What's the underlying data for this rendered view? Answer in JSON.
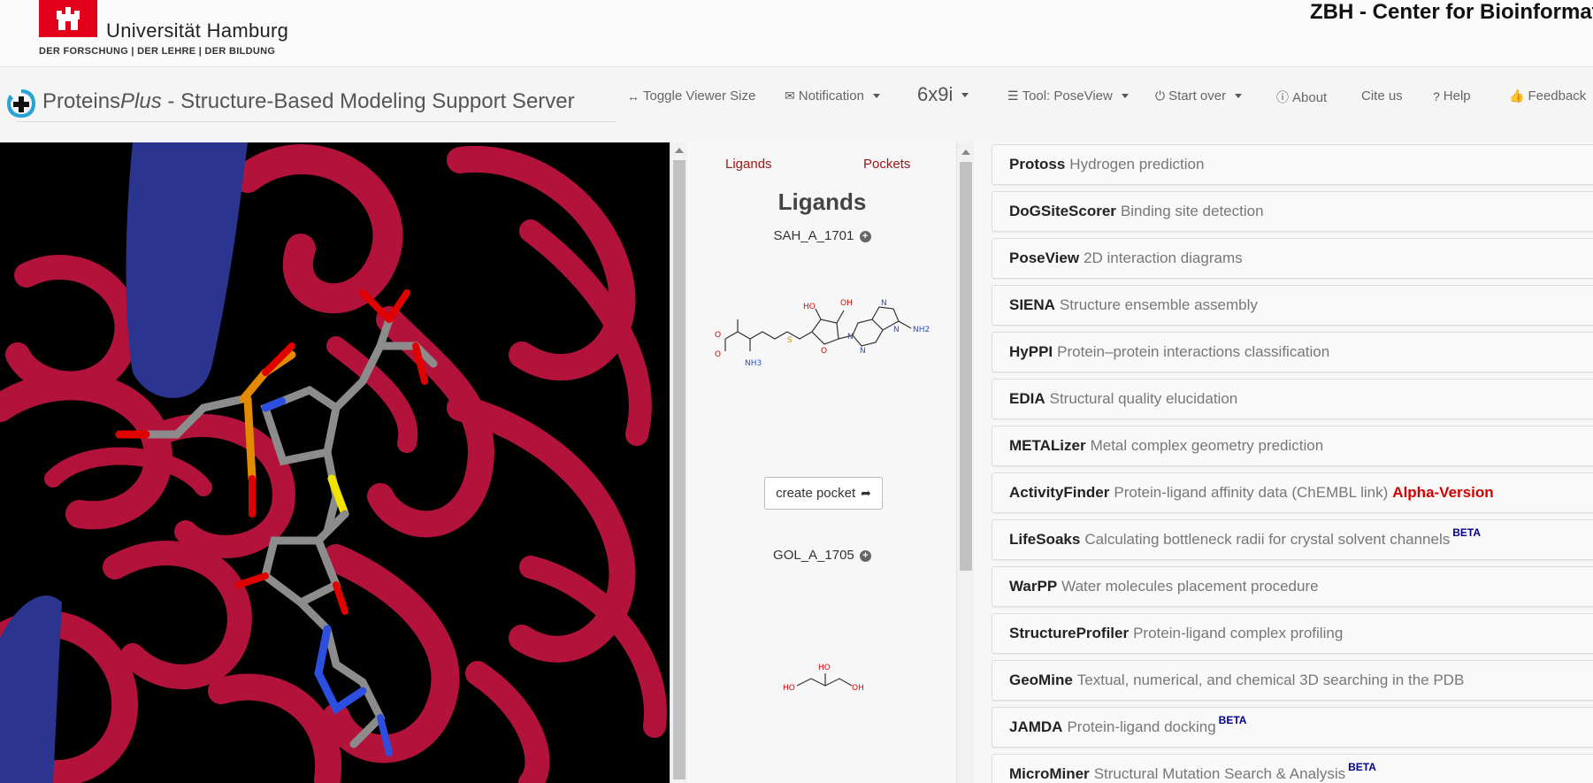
{
  "header": {
    "university_name": "Universität Hamburg",
    "university_tagline": "DER FORSCHUNG | DER LEHRE | DER BILDUNG",
    "zbh_title": "ZBH - Center for Bioinformatics"
  },
  "navbar": {
    "brand_prefix": "Proteins",
    "brand_italic": "Plus",
    "brand_suffix": " - Structure-Based Modeling Support Server",
    "toggle_viewer": "Toggle Viewer Size",
    "notification": "Notification",
    "pdb_code": "6x9i",
    "tool": "Tool: PoseView",
    "start_over": "Start over",
    "about": "About",
    "cite_us": "Cite us",
    "help": "Help",
    "feedback": "Feedback"
  },
  "ligand_panel": {
    "tab_ligands": "Ligands",
    "tab_pockets": "Pockets",
    "heading": "Ligands",
    "ligands": [
      {
        "name": "SAH_A_1701"
      },
      {
        "name": "GOL_A_1705"
      }
    ],
    "create_pocket": "create pocket",
    "atom_labels": {
      "ho": "HO",
      "oh": "OH",
      "nh2": "NH2",
      "nh3": "NH3",
      "o": "O",
      "s": "S",
      "n": "N"
    }
  },
  "tools": [
    {
      "name": "Protoss",
      "desc": "Hydrogen prediction"
    },
    {
      "name": "DoGSiteScorer",
      "desc": "Binding site detection"
    },
    {
      "name": "PoseView",
      "desc": "2D interaction diagrams"
    },
    {
      "name": "SIENA",
      "desc": "Structure ensemble assembly"
    },
    {
      "name": "HyPPI",
      "desc": "Protein–protein interactions classification"
    },
    {
      "name": "EDIA",
      "desc": "Structural quality elucidation"
    },
    {
      "name": "METALizer",
      "desc": "Metal complex geometry prediction"
    },
    {
      "name": "ActivityFinder",
      "desc": "Protein-ligand affinity data (ChEMBL link)",
      "alpha": "Alpha-Version"
    },
    {
      "name": "LifeSoaks",
      "desc": "Calculating bottleneck radii for crystal solvent channels",
      "beta": "BETA"
    },
    {
      "name": "WarPP",
      "desc": "Water molecules placement procedure"
    },
    {
      "name": "StructureProfiler",
      "desc": "Protein-ligand complex profiling"
    },
    {
      "name": "GeoMine",
      "desc": "Textual, numerical, and chemical 3D searching in the PDB"
    },
    {
      "name": "JAMDA",
      "desc": "Protein-ligand docking",
      "beta": "BETA"
    },
    {
      "name": "MicroMiner",
      "desc": "Structural Mutation Search & Analysis",
      "beta": "BETA"
    }
  ],
  "colors": {
    "uhh_red": "#e2001a",
    "ribbon_red": "#b3123a",
    "ribbon_blue": "#2b3590",
    "alpha_red": "#d40000",
    "beta_navy": "#00008b",
    "tab_red": "#a31515"
  }
}
